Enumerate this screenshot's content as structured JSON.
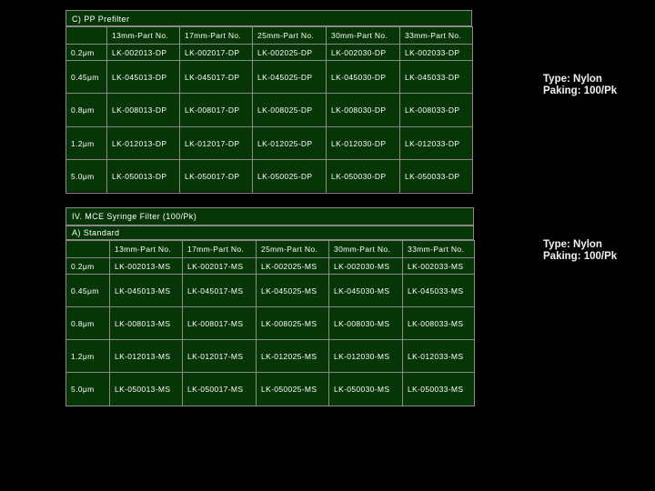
{
  "section_c": {
    "title": "C) PP Prefilter",
    "header": [
      "",
      "13mm-Part No.",
      "17mm-Part No.",
      "25mm-Part No.",
      "30mm-Part No.",
      "33mm-Part No."
    ],
    "rows": [
      [
        "0.2μm",
        "LK-002013-DP",
        "LK-002017-DP",
        "LK-002025-DP",
        "LK-002030-DP",
        "LK-002033-DP"
      ],
      [
        "0.45μm",
        "LK-045013-DP",
        "LK-045017-DP",
        "LK-045025-DP",
        "LK-045030-DP",
        "LK-045033-DP"
      ],
      [
        "0.8μm",
        "LK-008013-DP",
        "LK-008017-DP",
        "LK-008025-DP",
        "LK-008030-DP",
        "LK-008033-DP"
      ],
      [
        "1.2μm",
        "LK-012013-DP",
        "LK-012017-DP",
        "LK-012025-DP",
        "LK-012030-DP",
        "LK-012033-DP"
      ],
      [
        "5.0μm",
        "LK-050013-DP",
        "LK-050017-DP",
        "LK-050025-DP",
        "LK-050030-DP",
        "LK-050033-DP"
      ]
    ],
    "side_type": "Type: Nylon",
    "side_packing": "Paking: 100/Pk"
  },
  "section_iv": {
    "title": "IV. MCE Syringe Filter (100/Pk)",
    "subtitle": "A) Standard",
    "header": [
      "",
      "13mm-Part No.",
      "17mm-Part No.",
      "25mm-Part No.",
      "30mm-Part No.",
      "33mm-Part No."
    ],
    "rows": [
      [
        "0.2μm",
        "LK-002013-MS",
        "LK-002017-MS",
        "LK-002025-MS",
        "LK-002030-MS",
        "LK-002033-MS"
      ],
      [
        "0.45μm",
        "LK-045013-MS",
        "LK-045017-MS",
        "LK-045025-MS",
        "LK-045030-MS",
        "LK-045033-MS"
      ],
      [
        "0.8μm",
        "LK-008013-MS",
        "LK-008017-MS",
        "LK-008025-MS",
        "LK-008030-MS",
        "LK-008033-MS"
      ],
      [
        "1.2μm",
        "LK-012013-MS",
        "LK-012017-MS",
        "LK-012025-MS",
        "LK-012030-MS",
        "LK-012033-MS"
      ],
      [
        "5.0μm",
        "LK-050013-MS",
        "LK-050017-MS",
        "LK-050025-MS",
        "LK-050030-MS",
        "LK-050033-MS"
      ]
    ],
    "side_type": "Type: Nylon",
    "side_packing": "Paking: 100/Pk"
  }
}
